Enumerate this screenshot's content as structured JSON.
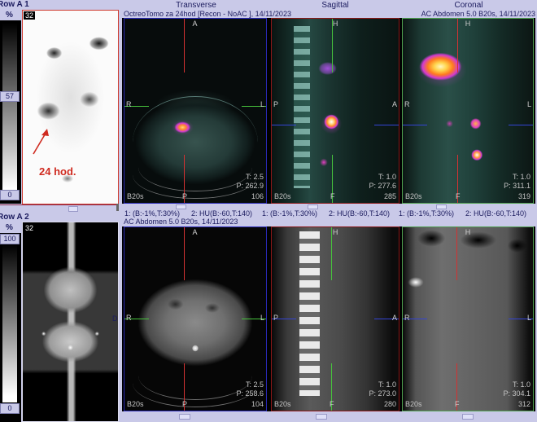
{
  "colors": {
    "lavender": "#c9c9e8",
    "navy": "#1b1b5e",
    "annotation-red": "#cf2b20",
    "border-transverse": "#2a2ab8",
    "border-sagittal": "#8b1818",
    "border-coronal": "#4fa04f",
    "crosshair-red": "#d43232",
    "crosshair-green": "#46c23c",
    "crosshair-blue": "#3444d4"
  },
  "sidebar": {
    "row_a1": {
      "title": "Row A 1",
      "percent": "%",
      "count": "32",
      "scale_upper": "57",
      "scale_lower": "0",
      "annotation": "24 hod."
    },
    "row_a2": {
      "title": "Row A 2",
      "percent": "%",
      "count": "32",
      "scale_upper": "100",
      "scale_lower": "0",
      "orientation_side": "D"
    }
  },
  "header": {
    "column_titles": [
      "Transverse",
      "Sagittal",
      "Coronal"
    ],
    "row1_left": "OctreoTomo za 24hod [Recon - NoAC ], 14/11/2023",
    "row1_right": "AC Abdomen 5.0 B20s, 14/11/2023",
    "row2_left": "AC Abdomen 5.0 B20s, 14/11/2023"
  },
  "window_settings": {
    "label1": "1: (B:-1%,T:30%)",
    "label2": "2: HU(B:-60,T:140)"
  },
  "panels": [
    {
      "top": "A",
      "left": "R",
      "right": "L",
      "bottom": "P",
      "t": "T: 2.5",
      "p": "P: 262.9",
      "series": "B20s",
      "slice": "106"
    },
    {
      "top": "H",
      "left": "P",
      "right": "A",
      "bottom": "F",
      "t": "T: 1.0",
      "p": "P: 277.6",
      "series": "B20s",
      "slice": "285"
    },
    {
      "top": "H",
      "left": "R",
      "right": "L",
      "bottom": "F",
      "t": "T: 1.0",
      "p": "P: 311.1",
      "series": "B20s",
      "slice": "319"
    },
    {
      "top": "A",
      "left": "R",
      "right": "L",
      "bottom": "P",
      "t": "T: 2.5",
      "p": "P: 258.6",
      "series": "B20s",
      "slice": "104"
    },
    {
      "top": "H",
      "left": "P",
      "right": "A",
      "bottom": "F",
      "t": "T: 1.0",
      "p": "P: 273.0",
      "series": "B20s",
      "slice": "280"
    },
    {
      "top": "H",
      "left": "R",
      "right": "L",
      "bottom": "F",
      "t": "T: 1.0",
      "p": "P: 304.1",
      "series": "B20s",
      "slice": "312"
    }
  ]
}
